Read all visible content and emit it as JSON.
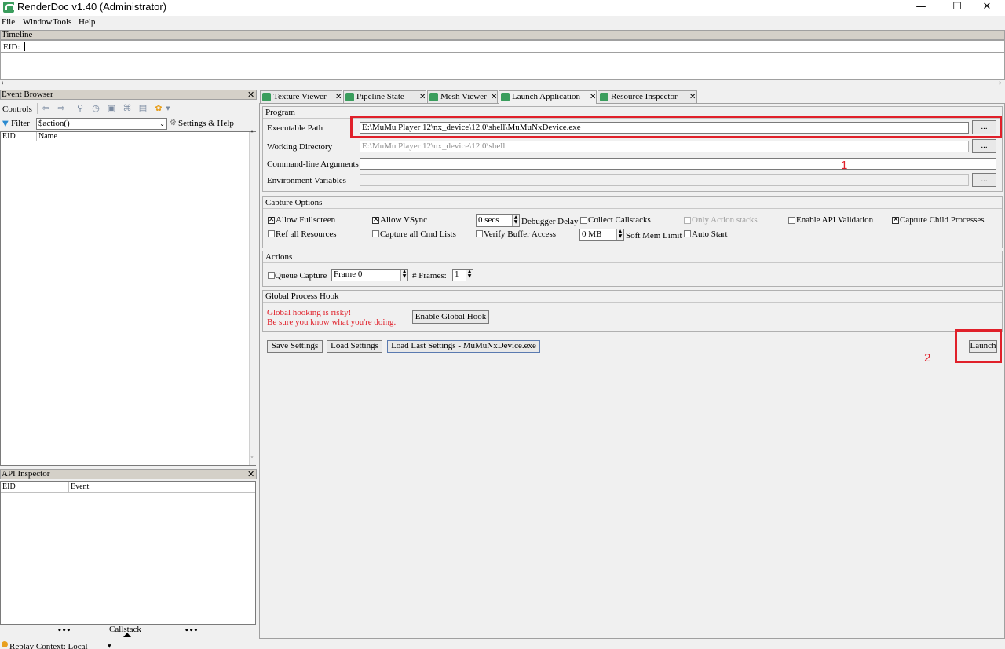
{
  "window": {
    "title": "RenderDoc v1.40 (Administrator)",
    "controls": {
      "minimize": "—",
      "maximize": "☐",
      "close": "✕"
    }
  },
  "menu": [
    "File",
    "Window",
    "Tools",
    "Help"
  ],
  "timeline": {
    "title": "Timeline",
    "eid_label": "EID:"
  },
  "event_browser": {
    "title": "Event Browser",
    "controls_label": "Controls",
    "filter_label": "Filter",
    "filter_value": "$action()",
    "settings_help": "Settings & Help",
    "columns": [
      "EID",
      "Name"
    ]
  },
  "api_inspector": {
    "title": "API Inspector",
    "columns": [
      "EID",
      "Event"
    ],
    "callstack_label": "Callstack",
    "dots": "•••"
  },
  "status": {
    "replay_context": "Replay Context: Local"
  },
  "tabs": [
    {
      "label": "Texture Viewer"
    },
    {
      "label": "Pipeline State"
    },
    {
      "label": "Mesh Viewer"
    },
    {
      "label": "Launch Application"
    },
    {
      "label": "Resource Inspector"
    }
  ],
  "program": {
    "title": "Program",
    "exe_label": "Executable Path",
    "exe_value": "E:\\MuMu Player 12\\nx_device\\12.0\\shell\\MuMuNxDevice.exe",
    "workdir_label": "Working Directory",
    "workdir_placeholder": "E:\\MuMu Player 12\\nx_device\\12.0\\shell",
    "cmdline_label": "Command-line Arguments",
    "cmdline_value": "",
    "env_label": "Environment Variables",
    "browse": "..."
  },
  "capture_options": {
    "title": "Capture Options",
    "allow_fullscreen": "Allow Fullscreen",
    "allow_vsync": "Allow VSync",
    "delay_value": "0 secs",
    "debugger_delay": "Debugger Delay",
    "collect_callstacks": "Collect Callstacks",
    "only_action_stacks": "Only Action stacks",
    "enable_api_validation": "Enable API Validation",
    "capture_child_processes": "Capture Child Processes",
    "ref_all_resources": "Ref all Resources",
    "capture_all_cmd_lists": "Capture all Cmd Lists",
    "verify_buffer_access": "Verify Buffer Access",
    "mem_value": "0 MB",
    "soft_mem_limit": "Soft Mem Limit",
    "auto_start": "Auto Start",
    "check_mark": "✕"
  },
  "actions": {
    "title": "Actions",
    "queue_capture": "Queue Capture",
    "frame_value": "Frame 0",
    "frames_label": "# Frames:",
    "frames_value": "1"
  },
  "global_hook": {
    "title": "Global Process Hook",
    "warning_1": "Global hooking is risky!",
    "warning_2": "Be sure you know what you're doing.",
    "enable_button": "Enable Global Hook"
  },
  "bottom_buttons": {
    "save": "Save Settings",
    "load": "Load Settings",
    "load_last": "Load Last Settings - MuMuNxDevice.exe",
    "launch": "Launch"
  },
  "annotations": {
    "one": "1",
    "two": "2"
  },
  "colors": {
    "highlight": "#e0202a",
    "warning_text": "#e0202a",
    "icon_green": "#3a9d5d"
  }
}
